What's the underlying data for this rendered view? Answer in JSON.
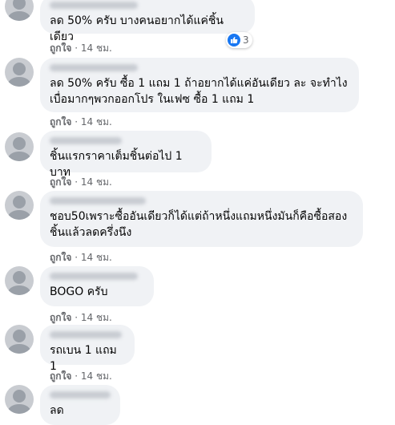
{
  "comments": [
    {
      "text": "ลด 50% ครับ บางคนอยากได้แค่ชิ้นเดียว",
      "like_label": "ถูกใจ",
      "time": "14 ชม.",
      "reaction_count": "3"
    },
    {
      "text": "ลด 50% ครับ ซื้อ 1 แถม 1 ถ้าอยากได้แค่อันเดียว ละ จะทำไง\nเบื่อมากๆพวกออกโปร ในเฟซ ซื้อ 1 แถม 1",
      "like_label": "ถูกใจ",
      "time": "14 ชม."
    },
    {
      "text": "ชิ้นแรกราคาเต็มชิ้นต่อไป 1 บาท",
      "like_label": "ถูกใจ",
      "time": "14 ชม."
    },
    {
      "text": "ชอบ50เพราะซื้ออันเดียวก็ได้แต่ถ้าหนึ่งแถมหนึ่งมันก็คือซื้อสอง\nชิ้นแล้วลดครึ่งนึง",
      "like_label": "ถูกใจ",
      "time": "14 ชม."
    },
    {
      "text": "BOGO ครับ",
      "like_label": "ถูกใจ",
      "time": "14 ชม."
    },
    {
      "text": "รถเบน 1 แถม 1",
      "like_label": "ถูกใจ",
      "time": "14 ชม."
    },
    {
      "text": "ลด",
      "like_label": "",
      "time": ""
    }
  ],
  "separator": "·",
  "colors": {
    "bubble": "#f0f2f5",
    "meta_text": "#65676b",
    "like_reaction": "#1877f2"
  },
  "icons": {
    "reaction": "thumbs-up-icon",
    "avatar": "user-avatar-icon"
  }
}
